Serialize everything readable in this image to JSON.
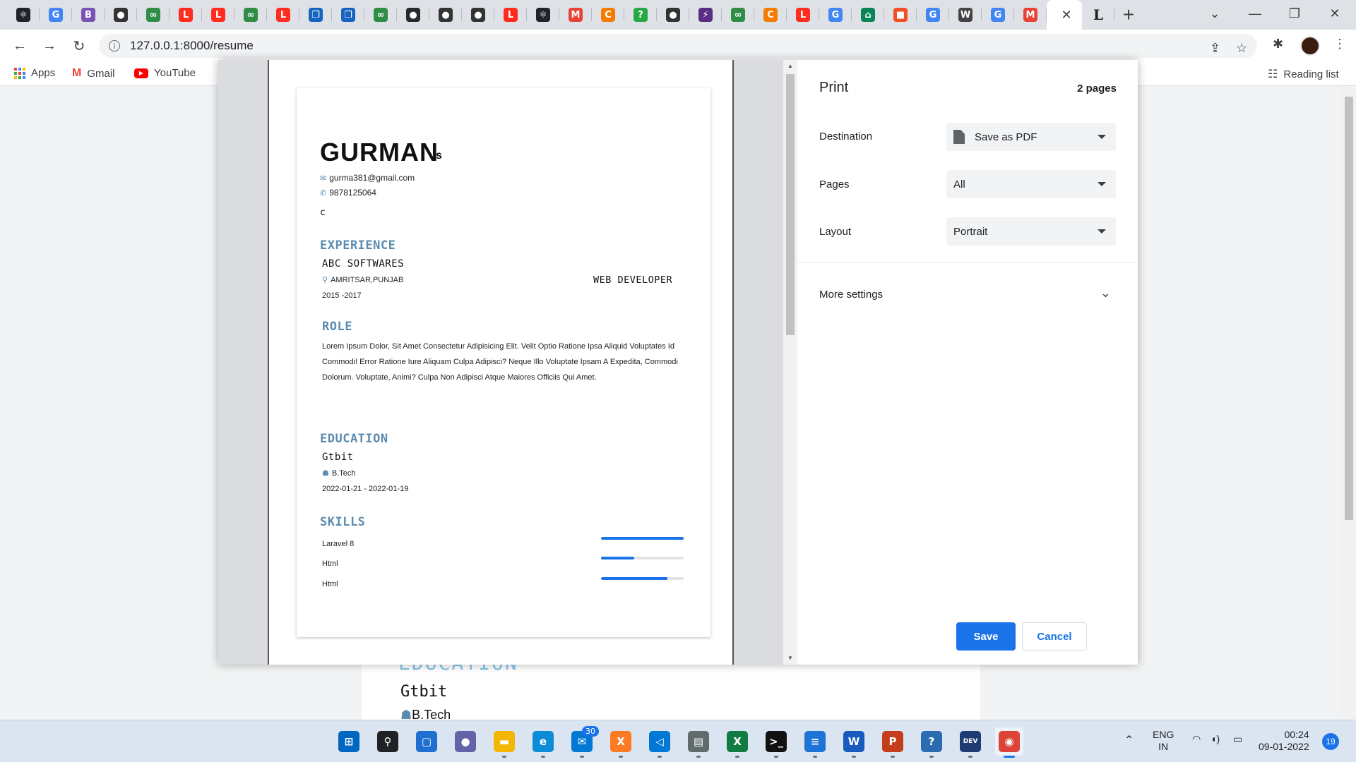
{
  "browser": {
    "tabs": [
      {
        "icon": "react-icon",
        "glyph": "⚛",
        "color": "#20232a"
      },
      {
        "icon": "google-icon",
        "glyph": "G",
        "color": "#4285f4"
      },
      {
        "icon": "bootstrap-icon",
        "glyph": "B",
        "color": "#7952b3"
      },
      {
        "icon": "globe-icon",
        "glyph": "●",
        "color": "#333333"
      },
      {
        "icon": "geeksforgeeks-icon",
        "glyph": "∞",
        "color": "#2f8d46"
      },
      {
        "icon": "laravel-icon",
        "glyph": "L",
        "color": "#ff2d20"
      },
      {
        "icon": "laravel-icon",
        "glyph": "L",
        "color": "#ff2d20"
      },
      {
        "icon": "geeksforgeeks-icon",
        "glyph": "∞",
        "color": "#2f8d46"
      },
      {
        "icon": "laravel-icon",
        "glyph": "L",
        "color": "#ff2d20"
      },
      {
        "icon": "copy-icon",
        "glyph": "❐",
        "color": "#1565c0"
      },
      {
        "icon": "copy-icon",
        "glyph": "❐",
        "color": "#1565c0"
      },
      {
        "icon": "geeksforgeeks-icon",
        "glyph": "∞",
        "color": "#2f8d46"
      },
      {
        "icon": "github-icon",
        "glyph": "●",
        "color": "#24292e"
      },
      {
        "icon": "globe-icon",
        "glyph": "●",
        "color": "#333333"
      },
      {
        "icon": "globe-icon",
        "glyph": "●",
        "color": "#333333"
      },
      {
        "icon": "laravel-icon",
        "glyph": "L",
        "color": "#ff2d20"
      },
      {
        "icon": "react-icon",
        "glyph": "⚛",
        "color": "#20232a"
      },
      {
        "icon": "gmail-icon",
        "glyph": "M",
        "color": "#ea4335"
      },
      {
        "icon": "codepen-icon",
        "glyph": "C",
        "color": "#f57c00"
      },
      {
        "icon": "question-icon",
        "glyph": "?",
        "color": "#28a745"
      },
      {
        "icon": "globe-icon",
        "glyph": "●",
        "color": "#333333"
      },
      {
        "icon": "bolt-icon",
        "glyph": "⚡",
        "color": "#5b2c83"
      },
      {
        "icon": "geeksforgeeks-icon",
        "glyph": "∞",
        "color": "#2f8d46"
      },
      {
        "icon": "codepen-icon",
        "glyph": "C",
        "color": "#f57c00"
      },
      {
        "icon": "laravel-icon",
        "glyph": "L",
        "color": "#ff2d20"
      },
      {
        "icon": "google-icon",
        "glyph": "G",
        "color": "#4285f4"
      },
      {
        "icon": "home-icon",
        "glyph": "⌂",
        "color": "#0b8457"
      },
      {
        "icon": "microsoft-icon",
        "glyph": "■",
        "color": "#f25022"
      },
      {
        "icon": "google-icon",
        "glyph": "G",
        "color": "#4285f4"
      },
      {
        "icon": "wikipedia-icon",
        "glyph": "W",
        "color": "#444444"
      },
      {
        "icon": "google-icon",
        "glyph": "G",
        "color": "#4285f4"
      },
      {
        "icon": "gmail-icon",
        "glyph": "M",
        "color": "#ea4335"
      }
    ],
    "active_tab_close": "✕",
    "after_tab_glyph": "L",
    "new_tab": "+",
    "url": "127.0.0.1:8000/resume",
    "bookmarks": [
      {
        "label": "Apps",
        "icon": "apps-grid-icon"
      },
      {
        "label": "Gmail",
        "icon": "gmail-icon"
      },
      {
        "label": "YouTube",
        "icon": "youtube-icon"
      }
    ],
    "reading_list": "Reading list"
  },
  "resume": {
    "name": "GURMAN",
    "surname": "s",
    "email": "gurma381@gmail.com",
    "phone": "9878125064",
    "summary": "c",
    "experience_heading": "EXPERIENCE",
    "company": "ABC SOFTWARES",
    "location": "AMRITSAR,PUNJAB",
    "years": "2015 -2017",
    "position": "WEB DEVELOPER",
    "role_heading": "ROLE",
    "role_text": "Lorem Ipsum Dolor, Sit Amet Consectetur Adipisicing Elit. Velit Optio Ratione Ipsa Aliquid Voluptates Id Commodi! Error Ratione Iure Aliquam Culpa Adipisci? Neque Illo Voluptate Ipsam A Expedita, Commodi Dolorum. Voluptate, Animi? Culpa Non Adipisci Atque Maiores Officiis Qui Amet.",
    "education_heading": "EDUCATION",
    "school": "Gtbit",
    "degree": "B.Tech",
    "edu_dates": "2022-01-21 - 2022-01-19",
    "skills_heading": "SKILLS",
    "skills": [
      {
        "name": "Laravel 8",
        "level": 1.0
      },
      {
        "name": "Html",
        "level": 0.4
      },
      {
        "name": "Html",
        "level": 0.8
      }
    ]
  },
  "behind_page": {
    "heading": "EDUCATION",
    "school": "Gtbit",
    "degree": "B.Tech"
  },
  "print_dialog": {
    "title": "Print",
    "pages_count": "2 pages",
    "destination_label": "Destination",
    "destination_value": "Save as PDF",
    "pages_label": "Pages",
    "pages_value": "All",
    "layout_label": "Layout",
    "layout_value": "Portrait",
    "more_settings": "More settings",
    "save": "Save",
    "cancel": "Cancel"
  },
  "taskbar": {
    "apps": [
      {
        "name": "start",
        "glyph": "⊞",
        "color": "#0067c0"
      },
      {
        "name": "search",
        "glyph": "⚲",
        "color": "#202124"
      },
      {
        "name": "task-view",
        "glyph": "▢",
        "color": "#1f6fd1"
      },
      {
        "name": "teams-chat",
        "glyph": "●",
        "color": "#6264a7"
      },
      {
        "name": "file-explorer",
        "glyph": "▬",
        "color": "#f2b705"
      },
      {
        "name": "edge",
        "glyph": "e",
        "color": "#0c8bd6"
      },
      {
        "name": "mail",
        "glyph": "✉",
        "color": "#0078d4",
        "badge": "30"
      },
      {
        "name": "xampp",
        "glyph": "X",
        "color": "#fb7a24"
      },
      {
        "name": "vscode",
        "glyph": "◁",
        "color": "#0078d4"
      },
      {
        "name": "sticky",
        "glyph": "▤",
        "color": "#5f6b6d"
      },
      {
        "name": "excel",
        "glyph": "X",
        "color": "#107c41"
      },
      {
        "name": "terminal",
        "glyph": ">_",
        "color": "#111111"
      },
      {
        "name": "notepad",
        "glyph": "≡",
        "color": "#1d74d6"
      },
      {
        "name": "word",
        "glyph": "W",
        "color": "#185abd"
      },
      {
        "name": "powerpoint",
        "glyph": "P",
        "color": "#c43e1c"
      },
      {
        "name": "help",
        "glyph": "?",
        "color": "#2b6cb0"
      },
      {
        "name": "dev-cpp",
        "glyph": "DEV",
        "color": "#1f3b73"
      },
      {
        "name": "chrome",
        "glyph": "◉",
        "color": "#db4437"
      }
    ],
    "lang_top": "ENG",
    "lang_bottom": "IN",
    "time": "00:24",
    "date": "09-01-2022",
    "notifications": "19"
  }
}
